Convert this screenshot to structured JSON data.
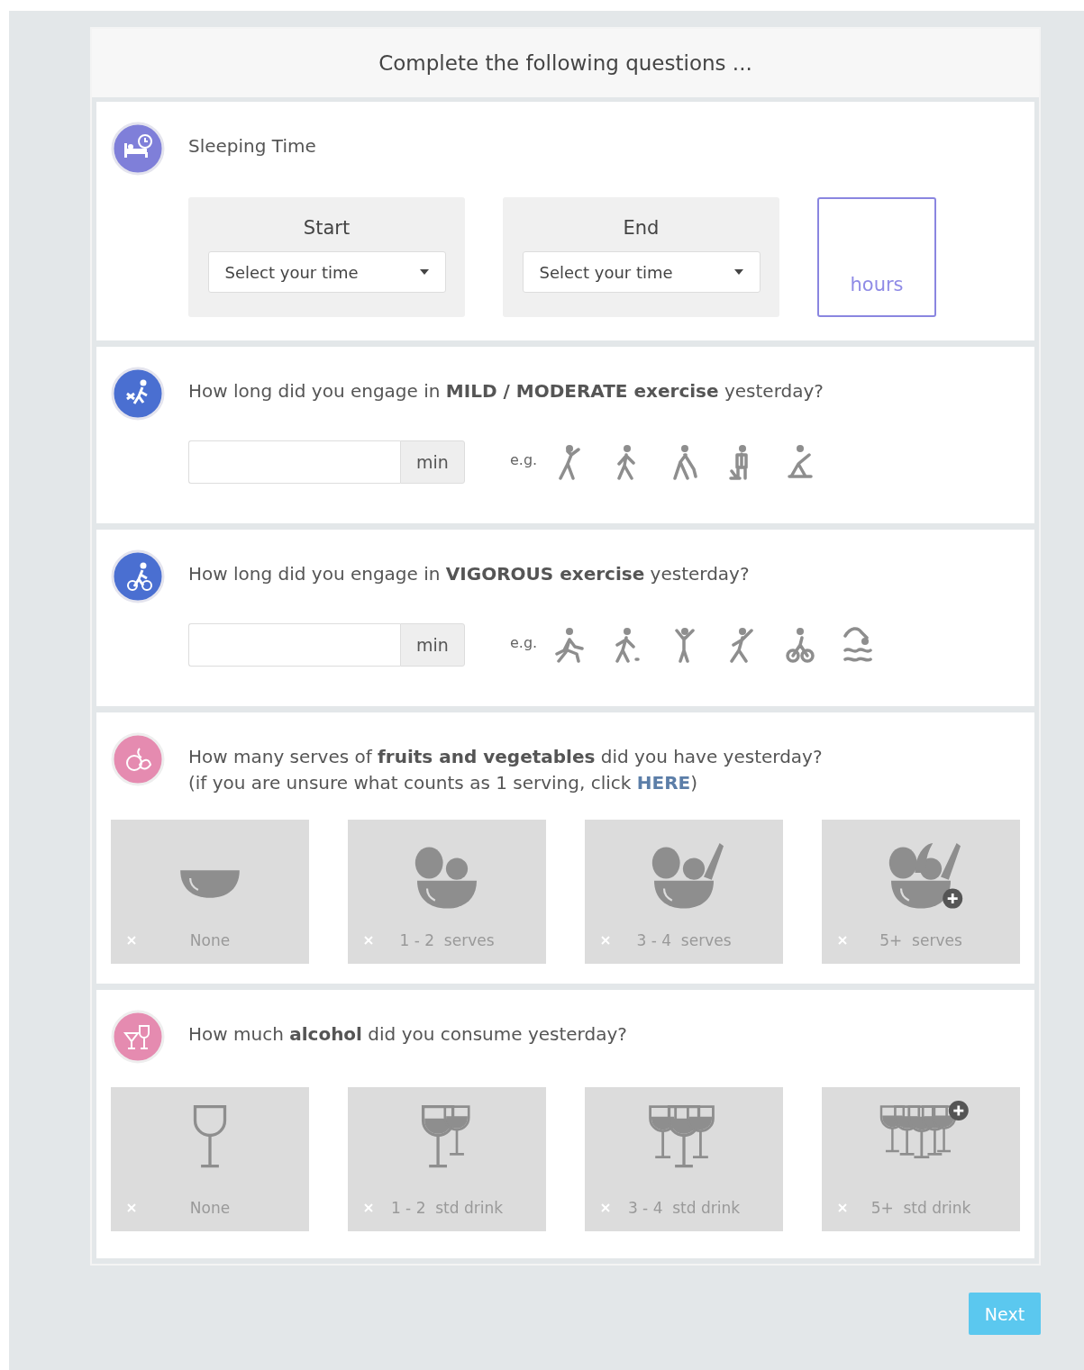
{
  "header": {
    "title": "Complete the following questions ..."
  },
  "sleep": {
    "title": "Sleeping Time",
    "color": "#7f7fd9",
    "pickers": [
      {
        "label": "Start",
        "placeholder": "Select your time"
      },
      {
        "label": "End",
        "placeholder": "Select your time"
      }
    ],
    "hours_unit": "hours"
  },
  "exercise": [
    {
      "question": "How long did you engage in **MILD / MODERATE exercise** yesterday?",
      "color": "#4a6fd1",
      "unit": "min",
      "eg": "e.g."
    },
    {
      "question": "How long did you engage in **VIGOROUS exercise** yesterday?",
      "color": "#4a6fd1",
      "unit": "min",
      "eg": "e.g."
    }
  ],
  "fruit": {
    "question": "How many serves of **fruits and vegetables** did you have yesterday?",
    "color": "#e58bb0",
    "hint_before": "(if you are unsure what counts as 1 serving, click ",
    "hint_link": "HERE",
    "hint_after": ")",
    "options": [
      {
        "label": "None",
        "selected": false
      },
      {
        "label": "1 - 2  serves",
        "selected": false
      },
      {
        "label": "3 - 4  serves",
        "selected": false
      },
      {
        "label": "5+  serves",
        "selected": false
      }
    ]
  },
  "alcohol": {
    "question": "How much **alcohol** did you consume yesterday?",
    "color": "#e58bb0",
    "options": [
      {
        "label": "None",
        "selected": false
      },
      {
        "label": "1 - 2  std drink",
        "selected": false
      },
      {
        "label": "3 - 4  std drink",
        "selected": false
      },
      {
        "label": "5+  std drink",
        "selected": false
      }
    ]
  },
  "next_button": "Next"
}
